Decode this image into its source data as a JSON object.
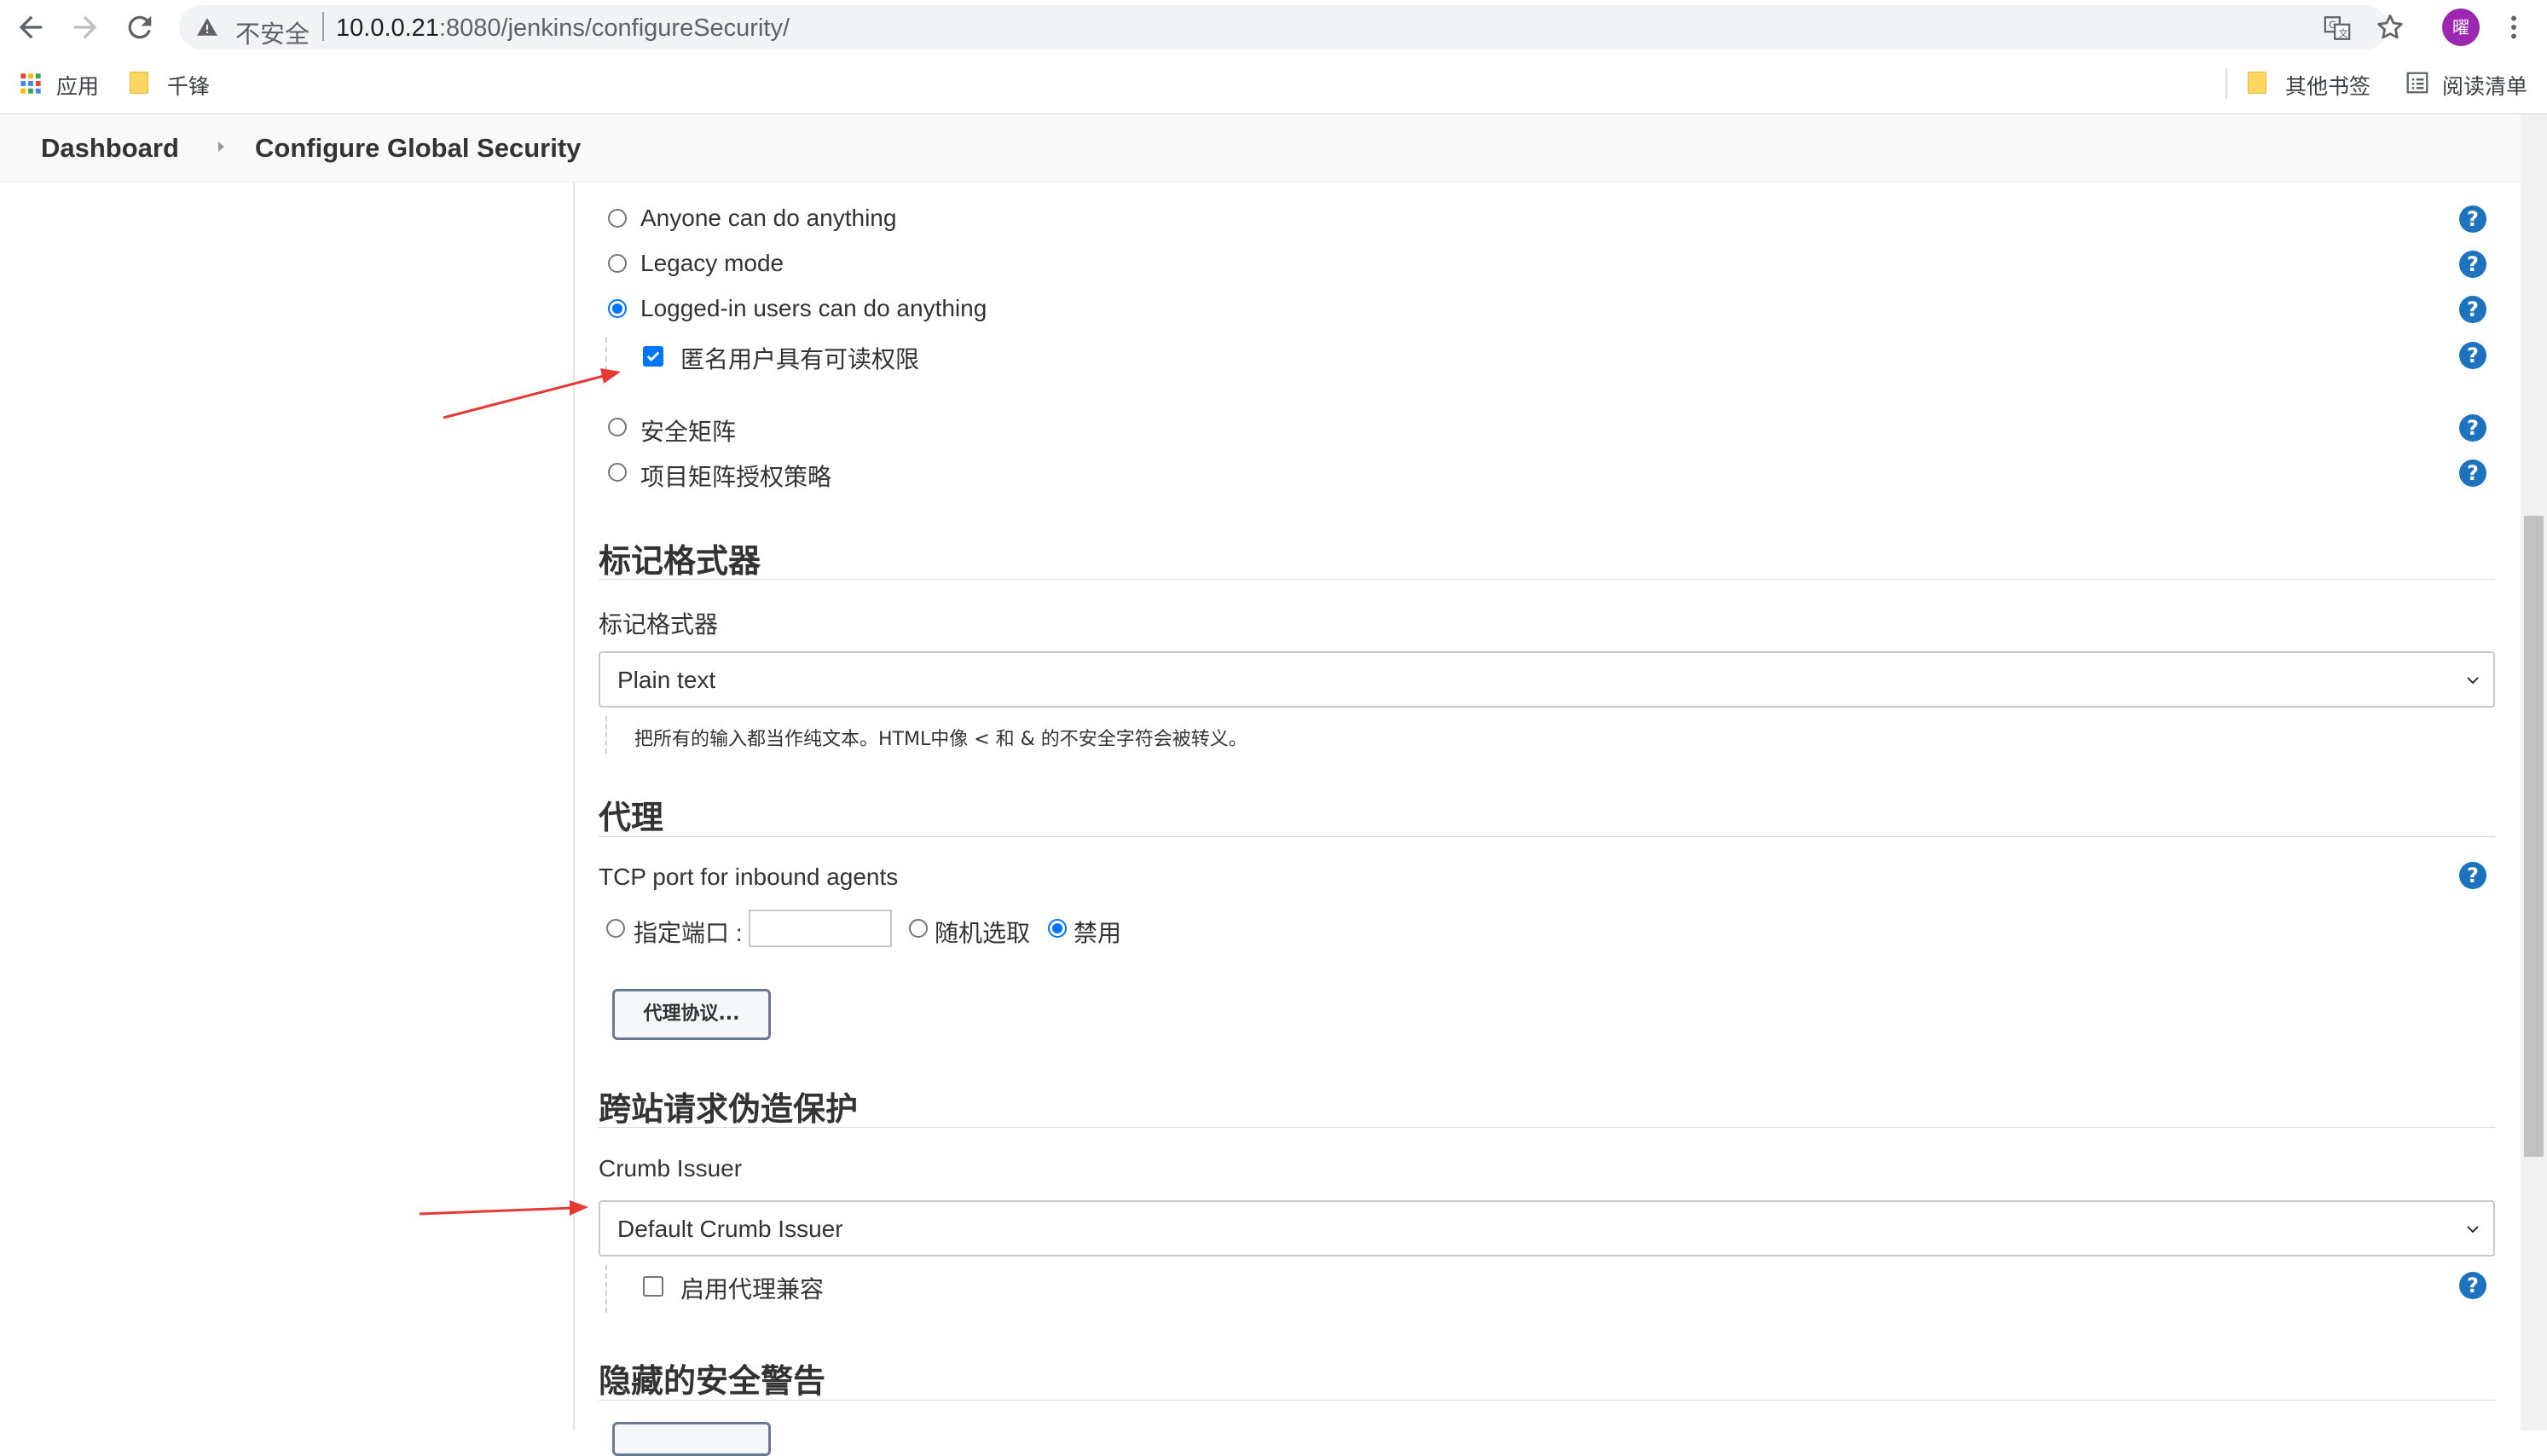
{
  "browser": {
    "security_label": "不安全",
    "url_host": "10.0.0.21",
    "url_path": ":8080/jenkins/configureSecurity/",
    "avatar_initial": "曜",
    "bookmarks": {
      "apps": "应用",
      "qianfeng": "千锋",
      "other": "其他书签",
      "reading_list": "阅读清单"
    }
  },
  "breadcrumb": {
    "dashboard": "Dashboard",
    "current": "Configure Global Security"
  },
  "authorization": {
    "options": [
      {
        "label": "Anyone can do anything",
        "checked": false
      },
      {
        "label": "Legacy mode",
        "checked": false
      },
      {
        "label": "Logged-in users can do anything",
        "checked": true
      },
      {
        "label": "安全矩阵",
        "checked": false
      },
      {
        "label": "项目矩阵授权策略",
        "checked": false
      }
    ],
    "anonymous_read": {
      "label": "匿名用户具有可读权限",
      "checked": true
    }
  },
  "markup_formatter": {
    "title": "标记格式器",
    "field_label": "标记格式器",
    "selected": "Plain text",
    "description": "把所有的输入都当作纯文本。HTML中像 < 和 & 的不安全字符会被转义。"
  },
  "agents": {
    "title": "代理",
    "tcp_label": "TCP port for inbound agents",
    "fixed_label": "指定端口 :",
    "fixed_value": "",
    "random_label": "随机选取",
    "disable_label": "禁用",
    "selected": "disable",
    "protocols_button": "代理协议..."
  },
  "csrf": {
    "title": "跨站请求伪造保护",
    "issuer_label": "Crumb Issuer",
    "issuer_selected": "Default Crumb Issuer",
    "proxy_compat_label": "启用代理兼容",
    "proxy_compat_checked": false
  },
  "hidden_warnings": {
    "title": "隐藏的安全警告"
  },
  "colors": {
    "accent": "#0075ff",
    "help": "#1e73be",
    "annotation": "#e53935"
  }
}
